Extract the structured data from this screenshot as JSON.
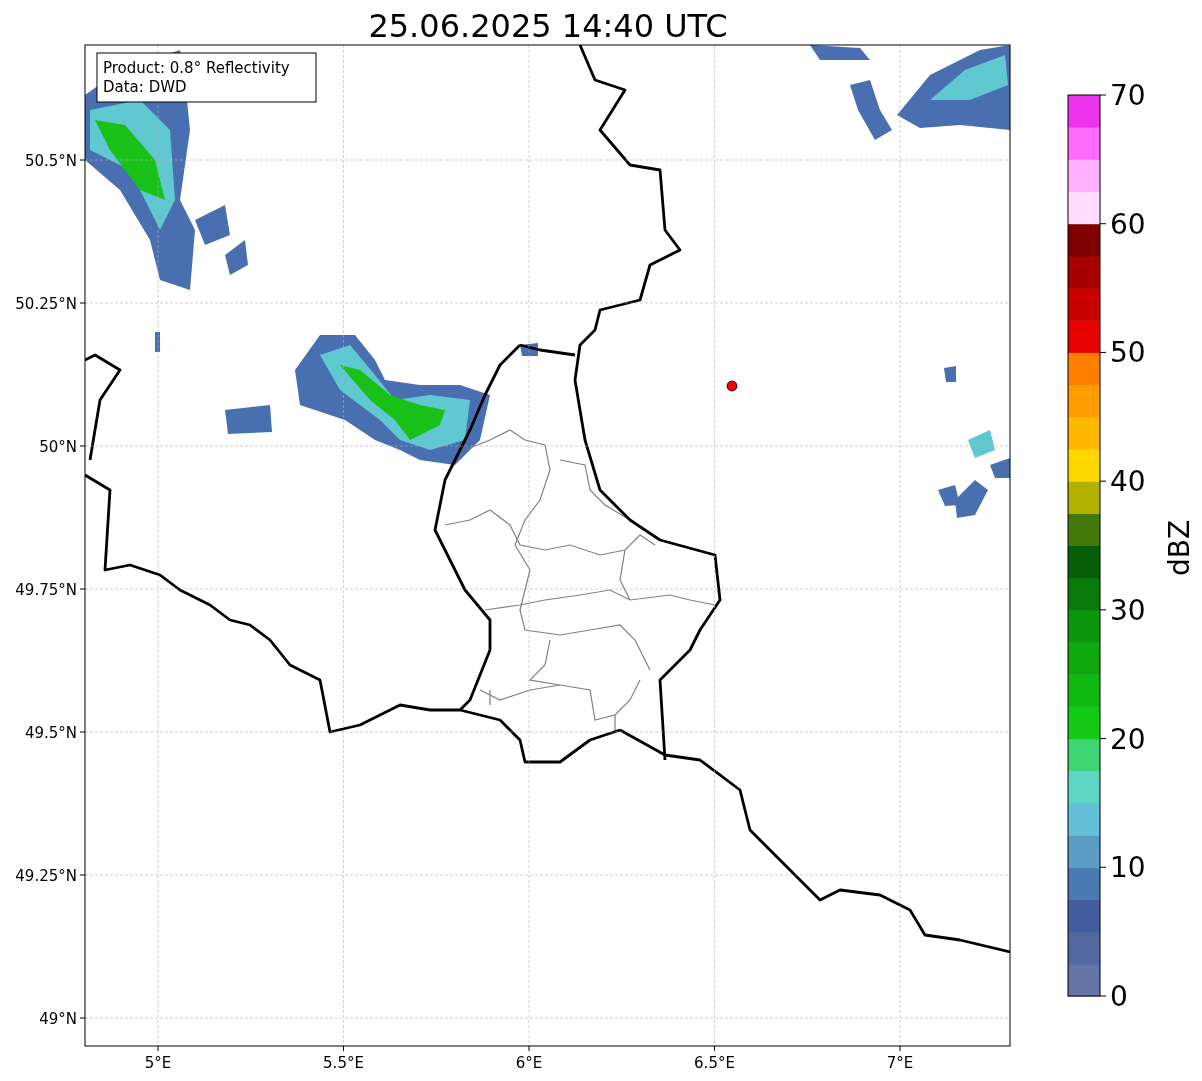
{
  "title": "25.06.2025 14:40 UTC",
  "map": {
    "info_box": [
      "Product: 0.8° Reflectivity",
      "Data: DWD"
    ],
    "xticks": [
      "5°E",
      "5.5°E",
      "6°E",
      "6.5°E",
      "7°E"
    ],
    "yticks": [
      "50.5°N",
      "50.25°N",
      "50°N",
      "49.75°N",
      "49.5°N",
      "49.25°N",
      "49°N"
    ]
  },
  "colorbar": {
    "label": "dBZ",
    "ticks": [
      "70",
      "60",
      "50",
      "40",
      "30",
      "20",
      "10",
      "0"
    ],
    "bins": [
      {
        "color": "#6675a8"
      },
      {
        "color": "#5266a0"
      },
      {
        "color": "#425ea0"
      },
      {
        "color": "#4a7ab2"
      },
      {
        "color": "#5a9cc4"
      },
      {
        "color": "#64c0d8"
      },
      {
        "color": "#5fd6c5"
      },
      {
        "color": "#3dd672"
      },
      {
        "color": "#14c914"
      },
      {
        "color": "#10b910"
      },
      {
        "color": "#0fa80f"
      },
      {
        "color": "#0c960c"
      },
      {
        "color": "#0a7a0a"
      },
      {
        "color": "#065e06"
      },
      {
        "color": "#457a0a"
      },
      {
        "color": "#b2b203"
      },
      {
        "color": "#ffd700"
      },
      {
        "color": "#ffb800"
      },
      {
        "color": "#ff9d00"
      },
      {
        "color": "#ff8000"
      },
      {
        "color": "#e60000"
      },
      {
        "color": "#c80000"
      },
      {
        "color": "#a80000"
      },
      {
        "color": "#7f0000"
      },
      {
        "color": "#ffddff"
      },
      {
        "color": "#ffb0ff"
      },
      {
        "color": "#ff6aff"
      },
      {
        "color": "#ee33ee"
      }
    ]
  }
}
